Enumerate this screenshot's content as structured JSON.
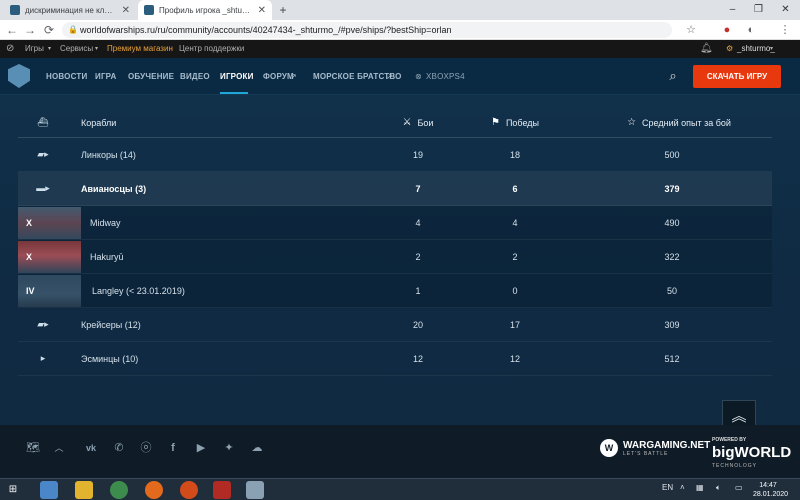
{
  "browser": {
    "tabs": [
      {
        "title": "дискриминация не клановых игроков",
        "active": false
      },
      {
        "title": "Профиль игрока _shturmo_ | World of Warships",
        "active": true
      }
    ],
    "new_tab_symbol": "+",
    "window_controls": [
      "–",
      "❐",
      "✕"
    ],
    "url": "worldofwarships.ru/ru/community/accounts/40247434-_shturmo_/#pve/ships/?bestShip=orlan"
  },
  "portal": {
    "games_label": "Игры",
    "services_label": "Сервисы",
    "premium_label": "Премиум магазин",
    "support_label": "Центр поддержки",
    "username": "_shturmo_"
  },
  "mainnav": {
    "items": [
      "НОВОСТИ",
      "ИГРА",
      "ОБУЧЕНИЕ",
      "ВИДЕО",
      "ИГРОКИ",
      "ФОРУМ",
      "МОРСКОЕ БРАТСТВО"
    ],
    "active_index": 4,
    "platforms": [
      "XBOX",
      "PS4"
    ],
    "download_label": "СКАЧАТЬ ИГРУ"
  },
  "table": {
    "headers": {
      "ships": "Корабли",
      "battles": "Бои",
      "wins": "Победы",
      "avg_xp": "Средний опыт за бой"
    },
    "rows": [
      {
        "icon": "▰▸",
        "name": "Линкоры (14)",
        "battles": "19",
        "wins": "18",
        "avg_xp": "500"
      },
      {
        "icon": "▬▸",
        "name": "Авианосцы (3)",
        "battles": "7",
        "wins": "6",
        "avg_xp": "379"
      },
      {
        "tier": "X",
        "name": "Midway",
        "battles": "4",
        "wins": "4",
        "avg_xp": "490"
      },
      {
        "tier": "X",
        "name": "Hakuryū",
        "battles": "2",
        "wins": "2",
        "avg_xp": "322"
      },
      {
        "tier": "IV",
        "name": "Langley (< 23.01.2019)",
        "battles": "1",
        "wins": "0",
        "avg_xp": "50"
      },
      {
        "icon": "▰▸",
        "name": "Крейсеры (12)",
        "battles": "20",
        "wins": "17",
        "avg_xp": "309"
      },
      {
        "icon": "▸",
        "name": "Эсминцы (10)",
        "battles": "12",
        "wins": "12",
        "avg_xp": "512"
      }
    ]
  },
  "footer": {
    "wargaming_name": "WARGAMING.NET",
    "wargaming_slogan": "LET'S BATTLE",
    "bigworld_powered": "POWERED BY",
    "bigworld_name": "bigWORLD",
    "bigworld_tech": "TECHNOLOGY"
  },
  "taskbar": {
    "lang": "EN",
    "time": "14:47",
    "date": "28.01.2020"
  },
  "colors": {
    "accent": "#e8380e",
    "active_underline": "#1fa5d8"
  }
}
